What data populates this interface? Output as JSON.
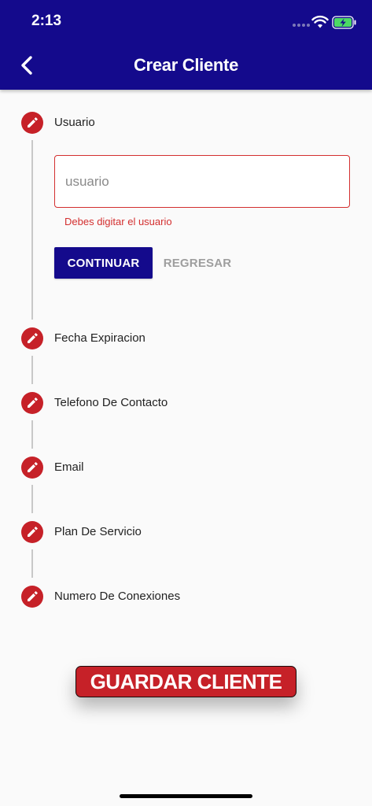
{
  "status_bar": {
    "time": "2:13"
  },
  "header": {
    "title": "Crear Cliente",
    "back_icon": "chevron-left-icon"
  },
  "steps": [
    {
      "label": "Usuario",
      "icon": "pencil-icon",
      "active": true
    },
    {
      "label": "Fecha Expiracion",
      "icon": "pencil-icon",
      "active": false
    },
    {
      "label": "Telefono De Contacto",
      "icon": "pencil-icon",
      "active": false
    },
    {
      "label": "Email",
      "icon": "pencil-icon",
      "active": false
    },
    {
      "label": "Plan De Servicio",
      "icon": "pencil-icon",
      "active": false
    },
    {
      "label": "Numero De Conexiones",
      "icon": "pencil-icon",
      "active": false
    }
  ],
  "user_field": {
    "placeholder": "usuario",
    "value": "",
    "error": "Debes digitar el usuario"
  },
  "actions": {
    "continue_label": "CONTINUAR",
    "back_label": "REGRESAR",
    "save_label": "GUARDAR CLIENTE"
  },
  "colors": {
    "header": "#140a8c",
    "accent": "#c62128",
    "error": "#d32f2f"
  }
}
